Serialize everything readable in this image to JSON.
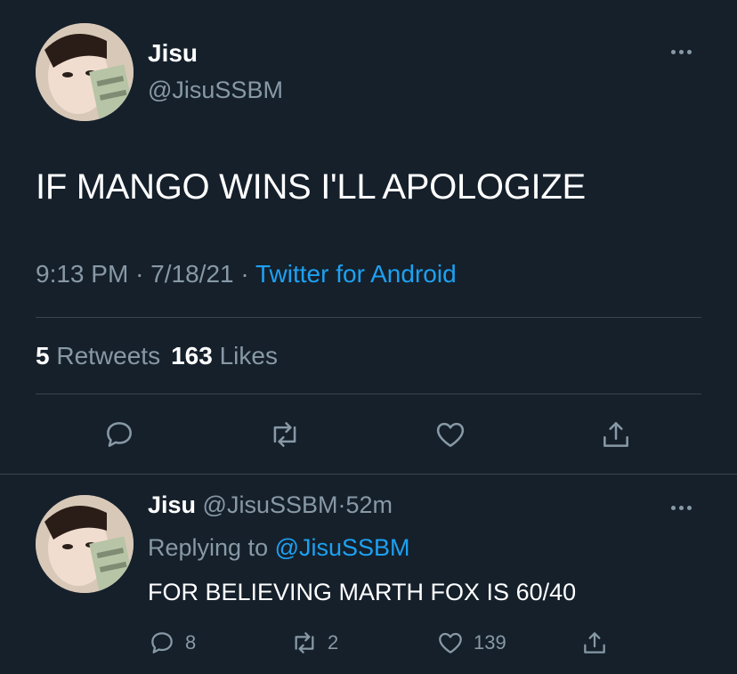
{
  "tweet": {
    "author_name": "Jisu",
    "author_handle": "@JisuSSBM",
    "text": "IF MANGO WINS I'LL APOLOGIZE",
    "time": "9:13 PM",
    "date": "7/18/21",
    "separator": "·",
    "source": "Twitter for Android",
    "retweets_count": "5",
    "retweets_label": "Retweets",
    "likes_count": "163",
    "likes_label": "Likes",
    "actions": [
      "reply-icon",
      "retweet-icon",
      "like-icon",
      "share-icon"
    ]
  },
  "reply": {
    "author_name": "Jisu",
    "author_handle": "@JisuSSBM",
    "separator": "·",
    "age": "52m",
    "replying_to_label": "Replying to",
    "replying_to_handle": "@JisuSSBM",
    "text": "FOR BELIEVING MARTH FOX IS 60/40",
    "reply_count": "8",
    "retweet_count": "2",
    "like_count": "139"
  },
  "colors": {
    "background": "#15202b",
    "secondary_text": "#8899a6",
    "accent": "#1da1f2",
    "divider": "#38444d"
  }
}
